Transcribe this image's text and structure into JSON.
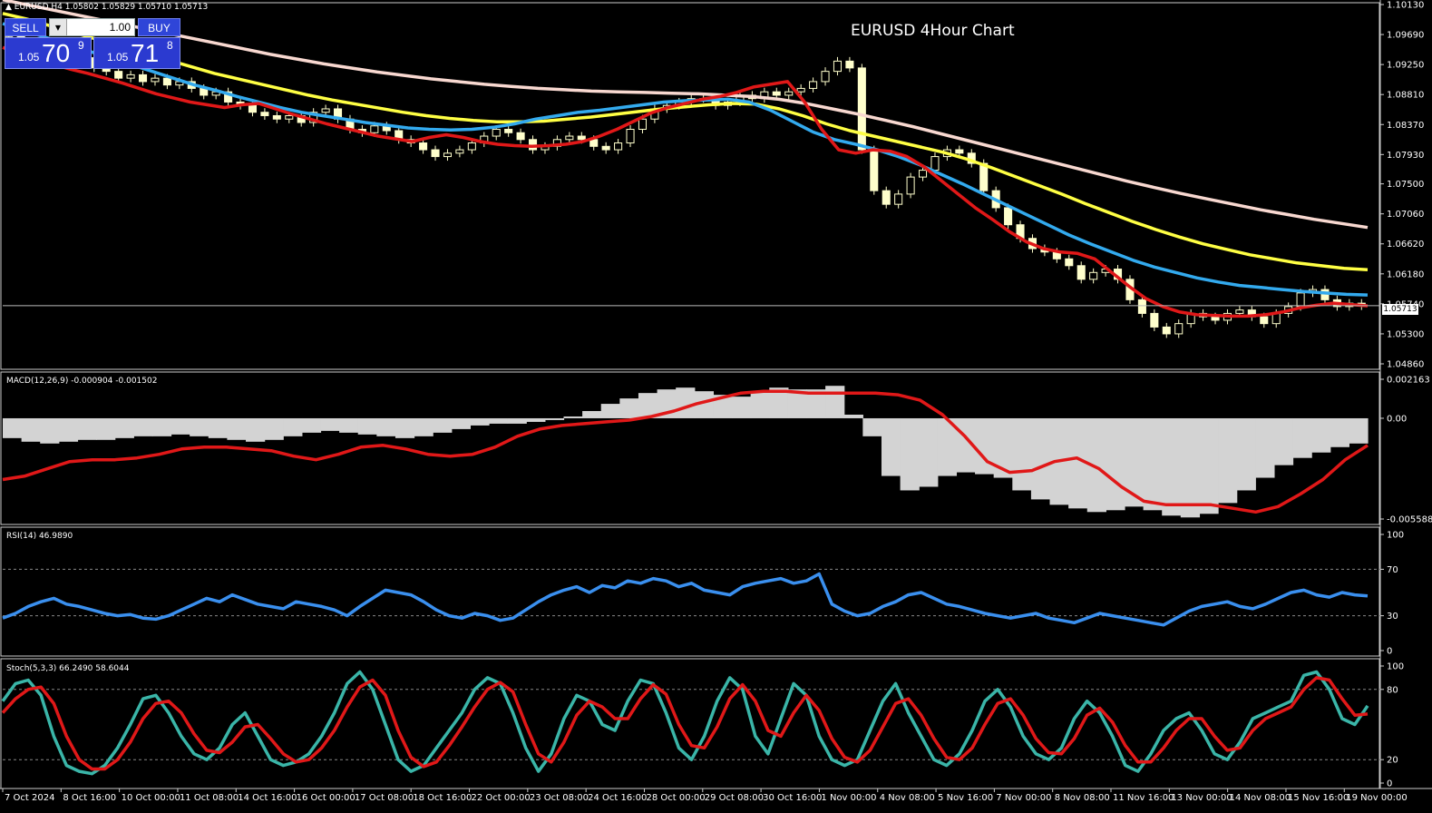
{
  "header": {
    "ohlc": "▲ EURUSD,H4 1.05802 1.05829 1.05710 1.05713",
    "chart_title": "EURUSD 4Hour Chart"
  },
  "trade_panel": {
    "sell_label": "SELL",
    "buy_label": "BUY",
    "lot_value": "1.00",
    "sell_price_small": "1.05",
    "sell_price_big": "70",
    "sell_price_sup": "9",
    "buy_price_small": "1.05",
    "buy_price_big": "71",
    "buy_price_sup": "8"
  },
  "current_price": "1.05713",
  "colors": {
    "background": "#000000",
    "ema_red": "#e01818",
    "ema_blue": "#33aaee",
    "ema_yellow": "#ffff44",
    "ema_pink": "#f8d8d0",
    "candle": "#ffffcc",
    "macd_hist": "#d3d3d3",
    "macd_signal": "#e01818",
    "rsi": "#3a8fee",
    "stoch_main": "#3ab5a8",
    "stoch_signal": "#e01818"
  },
  "indicators": {
    "macd_label": "MACD(12,26,9) -0.000904 -0.001502",
    "rsi_label": "RSI(14) 46.9890",
    "stoch_label": "Stoch(5,3,3) 66.2490 58.6044"
  },
  "chart_data": {
    "type": "line",
    "price_axis": {
      "ticks": [
        "1.10130",
        "1.09690",
        "1.09250",
        "1.08810",
        "1.08370",
        "1.07930",
        "1.07500",
        "1.07060",
        "1.06620",
        "1.06180",
        "1.05740",
        "1.05300",
        "1.04860"
      ],
      "ylim": [
        1.0486,
        1.1013
      ]
    },
    "macd_axis": {
      "ticks": [
        "0.002163",
        "0.00",
        "-0.005588"
      ],
      "ylim": [
        -0.005588,
        0.002163
      ]
    },
    "rsi_axis": {
      "ticks": [
        "100",
        "70",
        "30",
        "0"
      ],
      "levels": [
        70,
        30
      ]
    },
    "stoch_axis": {
      "ticks": [
        "100",
        "80",
        "20",
        "0"
      ],
      "levels": [
        80,
        20
      ]
    },
    "x_labels": [
      "7 Oct 2024",
      "8 Oct 16:00",
      "10 Oct 00:00",
      "11 Oct 08:00",
      "14 Oct 16:00",
      "16 Oct 00:00",
      "17 Oct 08:00",
      "18 Oct 16:00",
      "22 Oct 00:00",
      "23 Oct 08:00",
      "24 Oct 16:00",
      "28 Oct 00:00",
      "29 Oct 08:00",
      "30 Oct 16:00",
      "1 Nov 00:00",
      "4 Nov 08:00",
      "5 Nov 16:00",
      "7 Nov 00:00",
      "8 Nov 08:00",
      "11 Nov 16:00",
      "13 Nov 00:00",
      "14 Nov 08:00",
      "15 Nov 16:00",
      "19 Nov 00:00"
    ],
    "close": [
      1.0968,
      1.0955,
      1.0945,
      1.094,
      1.093,
      1.0925,
      1.0935,
      1.092,
      1.0915,
      1.0905,
      1.091,
      1.09,
      1.0905,
      1.0895,
      1.09,
      1.089,
      1.088,
      1.0885,
      1.087,
      1.0865,
      1.0855,
      1.085,
      1.0845,
      1.085,
      1.084,
      1.0855,
      1.086,
      1.0845,
      1.083,
      1.0825,
      1.0835,
      1.0828,
      1.0815,
      1.081,
      1.08,
      1.079,
      1.0795,
      1.08,
      1.081,
      1.082,
      1.083,
      1.0825,
      1.0815,
      1.08,
      1.0805,
      1.0815,
      1.082,
      1.0815,
      1.0805,
      1.08,
      1.081,
      1.083,
      1.0845,
      1.086,
      1.0865,
      1.087,
      1.0875,
      1.0875,
      1.0865,
      1.087,
      1.088,
      1.0875,
      1.0885,
      1.088,
      1.0885,
      1.089,
      1.09,
      1.0915,
      1.093,
      1.092,
      1.08,
      1.074,
      1.072,
      1.0735,
      1.076,
      1.077,
      1.079,
      1.08,
      1.0795,
      1.078,
      1.074,
      1.0715,
      1.069,
      1.067,
      1.0655,
      1.065,
      1.064,
      1.063,
      1.061,
      1.062,
      1.0625,
      1.061,
      1.058,
      1.056,
      1.054,
      1.053,
      1.0545,
      1.056,
      1.0555,
      1.055,
      1.056,
      1.0565,
      1.0555,
      1.0545,
      1.056,
      1.057,
      1.059,
      1.0595,
      1.058,
      1.057,
      1.0575,
      1.0571
    ],
    "ema_red": [
      1.095,
      1.094,
      1.0932,
      1.0925,
      1.0918,
      1.0912,
      1.0905,
      1.0898,
      1.089,
      1.0882,
      1.0876,
      1.087,
      1.0866,
      1.0862,
      1.0866,
      1.0868,
      1.086,
      1.0852,
      1.0845,
      1.0838,
      1.0832,
      1.0826,
      1.082,
      1.0816,
      1.0812,
      1.0818,
      1.0822,
      1.0818,
      1.0812,
      1.0808,
      1.0806,
      1.0805,
      1.0806,
      1.0808,
      1.0812,
      1.082,
      1.083,
      1.0842,
      1.0854,
      1.0862,
      1.0868,
      1.0874,
      1.0878,
      1.0884,
      1.0892,
      1.0896,
      1.09,
      1.087,
      1.083,
      1.08,
      1.0795,
      1.08,
      1.0798,
      1.079,
      1.0775,
      1.0755,
      1.0735,
      1.0715,
      1.0698,
      1.068,
      1.0665,
      1.0655,
      1.065,
      1.0648,
      1.064,
      1.062,
      1.06,
      1.0582,
      1.057,
      1.0562,
      1.0558,
      1.0557,
      1.0556,
      1.0556,
      1.0558,
      1.0562,
      1.0568,
      1.0572,
      1.0575,
      1.0573,
      1.0571
    ],
    "ema_blue": [
      1.0985,
      1.0975,
      1.0965,
      1.0955,
      1.0945,
      1.0935,
      1.0925,
      1.0915,
      1.0905,
      1.0895,
      1.0887,
      1.0878,
      1.087,
      1.0862,
      1.0855,
      1.085,
      1.0845,
      1.084,
      1.0836,
      1.0832,
      1.083,
      1.0829,
      1.083,
      1.0833,
      1.0838,
      1.0845,
      1.085,
      1.0855,
      1.0858,
      1.0862,
      1.0866,
      1.087,
      1.0872,
      1.0873,
      1.0874,
      1.087,
      1.0858,
      1.0842,
      1.0826,
      1.0815,
      1.0808,
      1.08,
      1.079,
      1.0778,
      1.0764,
      1.075,
      1.0735,
      1.072,
      1.0705,
      1.069,
      1.0675,
      1.0662,
      1.065,
      1.0638,
      1.0628,
      1.062,
      1.0612,
      1.0606,
      1.0601,
      1.0598,
      1.0595,
      1.0592,
      1.059,
      1.0588,
      1.0587
    ],
    "ema_yellow": [
      1.1,
      1.0992,
      1.0982,
      1.0972,
      1.0962,
      1.0952,
      1.0942,
      1.0932,
      1.0922,
      1.0912,
      1.0904,
      1.0896,
      1.0888,
      1.088,
      1.0873,
      1.0867,
      1.0861,
      1.0855,
      1.085,
      1.0846,
      1.0843,
      1.0841,
      1.0841,
      1.0842,
      1.0845,
      1.0848,
      1.0852,
      1.0856,
      1.086,
      1.0863,
      1.0866,
      1.0868,
      1.0867,
      1.086,
      1.085,
      1.0838,
      1.0828,
      1.082,
      1.0812,
      1.0804,
      1.0796,
      1.0786,
      1.0774,
      1.0761,
      1.0748,
      1.0735,
      1.0721,
      1.0708,
      1.0695,
      1.0683,
      1.0672,
      1.0662,
      1.0654,
      1.0646,
      1.064,
      1.0634,
      1.063,
      1.0626,
      1.0624
    ],
    "ema_pink": [
      1.102,
      1.1012,
      1.1004,
      1.0996,
      1.0988,
      1.098,
      1.0972,
      1.0964,
      1.0956,
      1.0948,
      1.094,
      1.0933,
      1.0926,
      1.092,
      1.0914,
      1.0909,
      1.0904,
      1.09,
      1.0896,
      1.0893,
      1.089,
      1.0888,
      1.0886,
      1.0885,
      1.0884,
      1.0883,
      1.0882,
      1.088,
      1.0878,
      1.0874,
      1.0868,
      1.086,
      1.0852,
      1.0843,
      1.0834,
      1.0824,
      1.0814,
      1.0804,
      1.0794,
      1.0784,
      1.0774,
      1.0764,
      1.0754,
      1.0745,
      1.0736,
      1.0728,
      1.072,
      1.0712,
      1.0705,
      1.0698,
      1.0692,
      1.0686
    ],
    "macd_hist": [
      -0.0011,
      -0.0013,
      -0.0014,
      -0.0013,
      -0.0012,
      -0.0012,
      -0.0011,
      -0.001,
      -0.001,
      -0.0009,
      -0.001,
      -0.0011,
      -0.0012,
      -0.0013,
      -0.0012,
      -0.001,
      -0.0008,
      -0.0007,
      -0.0008,
      -0.0009,
      -0.001,
      -0.0011,
      -0.001,
      -0.0008,
      -0.0006,
      -0.0004,
      -0.0003,
      -0.0003,
      -0.0002,
      -0.0001,
      0.0001,
      0.0004,
      0.0008,
      0.0011,
      0.0014,
      0.0016,
      0.0017,
      0.0015,
      0.0013,
      0.0012,
      0.0015,
      0.0017,
      0.0016,
      0.0016,
      0.0018,
      0.0002,
      -0.001,
      -0.0032,
      -0.004,
      -0.0038,
      -0.0032,
      -0.003,
      -0.0031,
      -0.0033,
      -0.004,
      -0.0045,
      -0.0048,
      -0.005,
      -0.0052,
      -0.0051,
      -0.0049,
      -0.0051,
      -0.0054,
      -0.0055,
      -0.0053,
      -0.0047,
      -0.004,
      -0.0033,
      -0.0026,
      -0.0022,
      -0.0019,
      -0.0016,
      -0.0014
    ],
    "macd_signal": [
      -0.0034,
      -0.0032,
      -0.0028,
      -0.0024,
      -0.0023,
      -0.0023,
      -0.0022,
      -0.002,
      -0.0017,
      -0.0016,
      -0.0016,
      -0.0017,
      -0.0018,
      -0.0021,
      -0.0023,
      -0.002,
      -0.0016,
      -0.0015,
      -0.0017,
      -0.002,
      -0.0021,
      -0.002,
      -0.0016,
      -0.001,
      -0.0006,
      -0.0004,
      -0.0003,
      -0.0002,
      -0.0001,
      0.0001,
      0.0004,
      0.0008,
      0.0011,
      0.0014,
      0.0015,
      0.0015,
      0.0014,
      0.0014,
      0.0014,
      0.0014,
      0.0013,
      0.001,
      0.0002,
      -0.001,
      -0.0024,
      -0.003,
      -0.0029,
      -0.0024,
      -0.0022,
      -0.0028,
      -0.0038,
      -0.0046,
      -0.0048,
      -0.0048,
      -0.0048,
      -0.005,
      -0.0052,
      -0.0049,
      -0.0042,
      -0.0034,
      -0.0023,
      -0.0015
    ],
    "rsi": [
      28,
      32,
      38,
      42,
      45,
      40,
      38,
      35,
      32,
      30,
      31,
      28,
      27,
      30,
      35,
      40,
      45,
      42,
      48,
      44,
      40,
      38,
      36,
      42,
      40,
      38,
      35,
      30,
      38,
      45,
      52,
      50,
      48,
      42,
      35,
      30,
      28,
      32,
      30,
      26,
      28,
      35,
      42,
      48,
      52,
      55,
      50,
      56,
      54,
      60,
      58,
      62,
      60,
      55,
      58,
      52,
      50,
      48,
      55,
      58,
      60,
      62,
      58,
      60,
      66,
      40,
      34,
      30,
      32,
      38,
      42,
      48,
      50,
      45,
      40,
      38,
      35,
      32,
      30,
      28,
      30,
      32,
      28,
      26,
      24,
      28,
      32,
      30,
      28,
      26,
      24,
      22,
      28,
      34,
      38,
      40,
      42,
      38,
      36,
      40,
      45,
      50,
      52,
      48,
      46,
      50,
      48,
      47
    ],
    "stoch_main": [
      70,
      85,
      88,
      75,
      40,
      15,
      10,
      8,
      15,
      30,
      50,
      72,
      75,
      60,
      40,
      25,
      20,
      30,
      50,
      60,
      40,
      20,
      15,
      18,
      25,
      40,
      60,
      85,
      95,
      80,
      50,
      20,
      10,
      15,
      30,
      45,
      60,
      80,
      90,
      85,
      60,
      30,
      10,
      25,
      55,
      75,
      70,
      50,
      45,
      70,
      88,
      85,
      60,
      30,
      20,
      40,
      70,
      90,
      80,
      40,
      25,
      55,
      85,
      75,
      40,
      20,
      15,
      20,
      45,
      70,
      85,
      60,
      40,
      20,
      15,
      25,
      45,
      70,
      80,
      65,
      40,
      25,
      20,
      30,
      55,
      70,
      60,
      40,
      15,
      10,
      25,
      45,
      55,
      60,
      45,
      25,
      20,
      35,
      55,
      60,
      65,
      70,
      92,
      95,
      80,
      55,
      50,
      66
    ],
    "stoch_signal": [
      60,
      72,
      80,
      82,
      68,
      40,
      20,
      12,
      12,
      20,
      35,
      55,
      68,
      70,
      60,
      42,
      28,
      26,
      35,
      48,
      50,
      38,
      25,
      18,
      20,
      30,
      45,
      65,
      82,
      88,
      75,
      45,
      22,
      14,
      18,
      32,
      48,
      65,
      80,
      86,
      78,
      50,
      25,
      18,
      35,
      58,
      70,
      65,
      55,
      55,
      72,
      84,
      76,
      50,
      32,
      30,
      48,
      72,
      84,
      70,
      45,
      40,
      60,
      75,
      62,
      38,
      22,
      18,
      28,
      48,
      68,
      72,
      58,
      38,
      22,
      20,
      30,
      50,
      68,
      72,
      58,
      38,
      26,
      25,
      38,
      58,
      64,
      52,
      32,
      18,
      18,
      30,
      45,
      55,
      55,
      40,
      28,
      30,
      45,
      55,
      60,
      65,
      80,
      90,
      88,
      72,
      58,
      59
    ]
  }
}
